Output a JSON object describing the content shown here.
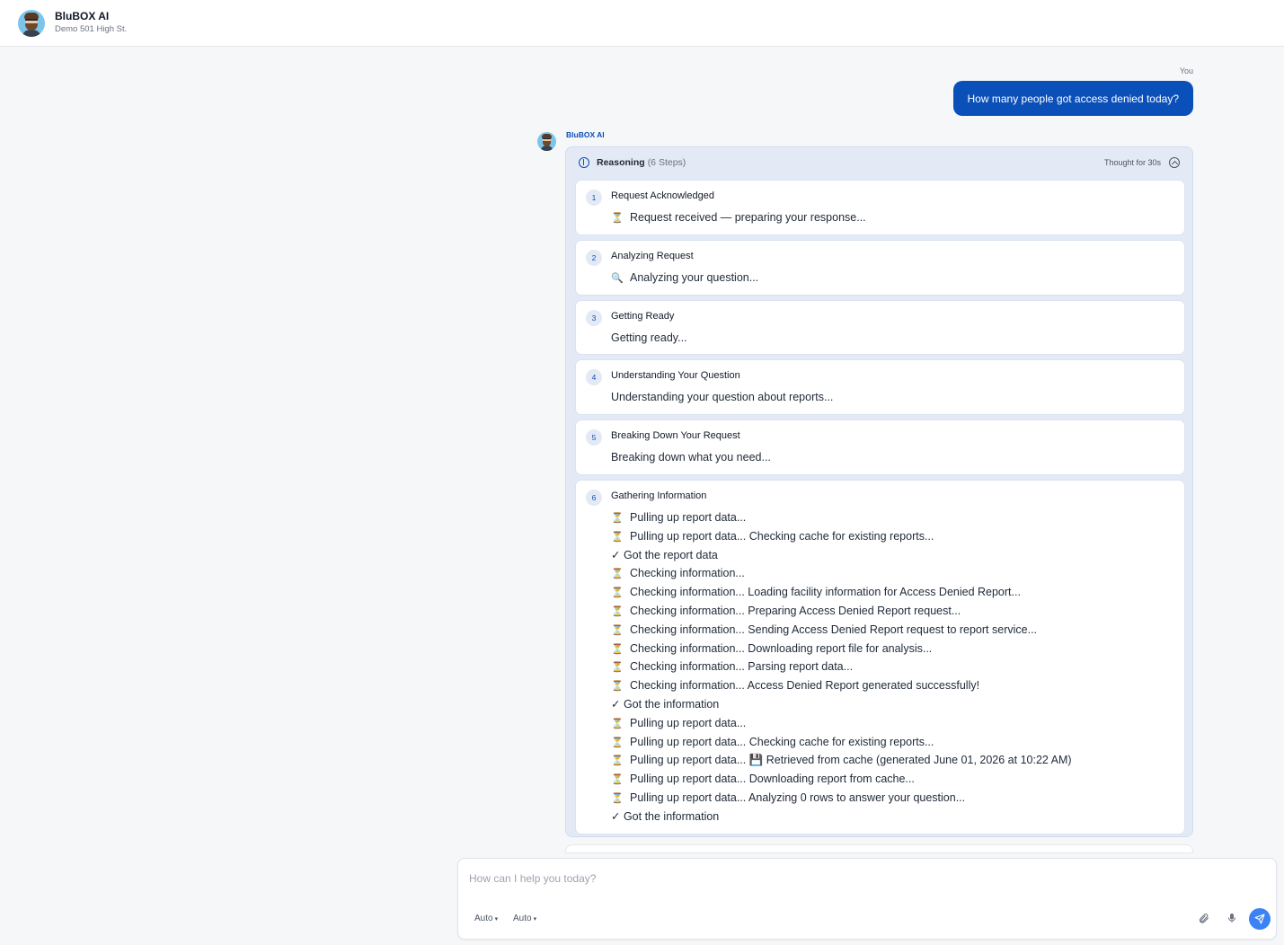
{
  "header": {
    "app_name": "BluBOX AI",
    "subtitle": "Demo 501 High St."
  },
  "conversation": {
    "user_label": "You",
    "user_message": "How many people got access denied today?",
    "assistant_name": "BluBOX AI"
  },
  "reasoning": {
    "title": "Reasoning",
    "steps_count": "(6 Steps)",
    "thought_time": "Thought for 30s",
    "steps": [
      {
        "number": "1",
        "title": "Request Acknowledged",
        "lines": [
          {
            "icon": "hourglass",
            "glyph": "⏳",
            "text": "Request received — preparing your response..."
          }
        ]
      },
      {
        "number": "2",
        "title": "Analyzing Request",
        "lines": [
          {
            "icon": "magnifier",
            "glyph": "🔍",
            "text": "Analyzing your question..."
          }
        ]
      },
      {
        "number": "3",
        "title": "Getting Ready",
        "lines": [
          {
            "icon": "",
            "glyph": "",
            "text": "Getting ready..."
          }
        ]
      },
      {
        "number": "4",
        "title": "Understanding Your Question",
        "lines": [
          {
            "icon": "",
            "glyph": "",
            "text": "Understanding your question about reports..."
          }
        ]
      },
      {
        "number": "5",
        "title": "Breaking Down Your Request",
        "lines": [
          {
            "icon": "",
            "glyph": "",
            "text": "Breaking down what you need..."
          }
        ]
      },
      {
        "number": "6",
        "title": "Gathering Information",
        "lines": [
          {
            "icon": "hourglass",
            "glyph": "⏳",
            "text": "Pulling up report data..."
          },
          {
            "icon": "hourglass",
            "glyph": "⏳",
            "text": "Pulling up report data... Checking cache for existing reports..."
          },
          {
            "icon": "",
            "glyph": "",
            "text": "✓ Got the report data"
          },
          {
            "icon": "hourglass",
            "glyph": "⏳",
            "text": "Checking information..."
          },
          {
            "icon": "hourglass",
            "glyph": "⏳",
            "text": "Checking information... Loading facility information for Access Denied Report..."
          },
          {
            "icon": "hourglass",
            "glyph": "⏳",
            "text": "Checking information... Preparing Access Denied Report request..."
          },
          {
            "icon": "hourglass",
            "glyph": "⏳",
            "text": "Checking information... Sending Access Denied Report request to report service..."
          },
          {
            "icon": "hourglass",
            "glyph": "⏳",
            "text": "Checking information... Downloading report file for analysis..."
          },
          {
            "icon": "hourglass",
            "glyph": "⏳",
            "text": "Checking information... Parsing report data..."
          },
          {
            "icon": "hourglass",
            "glyph": "⏳",
            "text": "Checking information... Access Denied Report generated successfully!"
          },
          {
            "icon": "",
            "glyph": "",
            "text": "✓ Got the information"
          },
          {
            "icon": "hourglass",
            "glyph": "⏳",
            "text": "Pulling up report data..."
          },
          {
            "icon": "hourglass",
            "glyph": "⏳",
            "text": "Pulling up report data... Checking cache for existing reports..."
          },
          {
            "icon": "hourglass",
            "glyph": "⏳",
            "text": "Pulling up report data... 💾 Retrieved from cache (generated June 01, 2026 at 10:22 AM)"
          },
          {
            "icon": "hourglass",
            "glyph": "⏳",
            "text": "Pulling up report data... Downloading report from cache..."
          },
          {
            "icon": "hourglass",
            "glyph": "⏳",
            "text": "Pulling up report data... Analyzing 0 rows to answer your question..."
          },
          {
            "icon": "",
            "glyph": "",
            "text": "✓ Got the information"
          }
        ]
      }
    ]
  },
  "composer": {
    "placeholder": "How can I help you today?",
    "value": "",
    "selector_1": "Auto",
    "selector_2": "Auto"
  },
  "colors": {
    "accent": "#0b4fb8",
    "send_button": "#3b82f6",
    "panel": "#e3eaf5"
  }
}
